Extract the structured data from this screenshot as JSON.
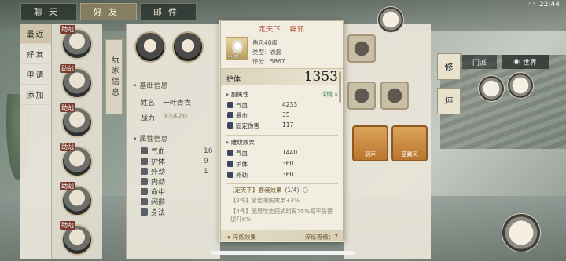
{
  "tabs": [
    "聊天",
    "好友",
    "邮件"
  ],
  "active_tab": 1,
  "status": {
    "time": "22:44"
  },
  "left_nav": [
    "最近",
    "好友",
    "申请",
    "添加"
  ],
  "friend_tag": "助战",
  "vertical_tab": "玩家信息",
  "player": {
    "basic_title": "基础信息",
    "name_label": "姓名",
    "name_value": "一叶青衣",
    "power_label": "战力",
    "power_value": "33420",
    "attr_title": "属性信息",
    "attrs": [
      {
        "name": "气血",
        "value": "16"
      },
      {
        "name": "护体",
        "value": "9"
      },
      {
        "name": "外劲",
        "value": "1"
      },
      {
        "name": "内劲",
        "value": ""
      },
      {
        "name": "命中",
        "value": ""
      },
      {
        "name": "闪避",
        "value": ""
      },
      {
        "name": "身法",
        "value": ""
      }
    ]
  },
  "slots_labels": [
    "羽声",
    "蓝翼风"
  ],
  "hud": {
    "menpai": "门派",
    "world": "世界",
    "seal1": "修",
    "seal2": "坪"
  },
  "tooltip": {
    "title": "定天下 · 辟邪",
    "item_level": "40级",
    "role_level": "角色40级",
    "type": "类型：衣服",
    "score": "评分：5867",
    "stat_name": "护体",
    "stat_value": "1353",
    "sub_title": "副属性",
    "detail_link": "详情",
    "sub_attrs": [
      {
        "name": "气血",
        "value": "4233"
      },
      {
        "name": "暴击",
        "value": "35"
      },
      {
        "name": "固定伤害",
        "value": "117"
      }
    ],
    "carve_title": "雕纹效果",
    "carve_attrs": [
      {
        "name": "气血",
        "value": "1440"
      },
      {
        "name": "护体",
        "value": "360"
      },
      {
        "name": "外劲",
        "value": "360"
      }
    ],
    "set_title": "【定天下】套装效果",
    "set_count": "(1/4)",
    "set_effects": [
      "【2件】受击减伤效果+3%",
      "【4件】施展攻击招式时有75%概率伤害提升6%"
    ],
    "temper_title": "淬炼效果",
    "temper_level": "淬炼等级：7"
  }
}
